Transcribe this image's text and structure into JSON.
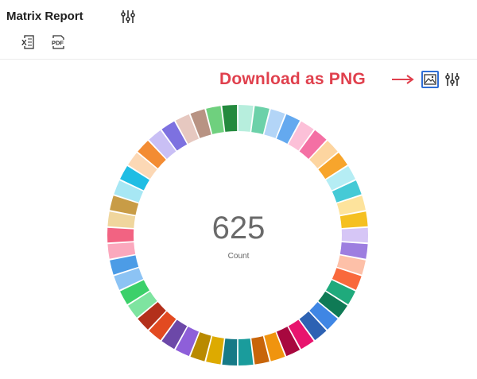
{
  "header": {
    "title": "Matrix Report",
    "settings_icon": "sliders-icon",
    "export_excel_icon": "excel-export-icon",
    "export_pdf_icon": "pdf-export-icon"
  },
  "annotation": {
    "text": "Download as PNG",
    "color": "#e0404d",
    "arrow_icon": "right-arrow-icon"
  },
  "chart_toolbar": {
    "download_png_icon": "image-icon",
    "settings_icon": "sliders-icon",
    "highlight_color": "#2f6ed6"
  },
  "chart_data": {
    "type": "pie",
    "donut": true,
    "total": "625",
    "total_label": "Count",
    "colors": [
      "#b7eedd",
      "#6cd1a9",
      "#b3d5f7",
      "#64a9ef",
      "#fcc0d8",
      "#f470a4",
      "#fdd5a0",
      "#f7a52c",
      "#b5edf4",
      "#45cad6",
      "#fde39c",
      "#f5c021",
      "#d6c6f6",
      "#9d7ee0",
      "#fdc0a8",
      "#f9693c",
      "#1faa7c",
      "#0f7a55",
      "#3f86e4",
      "#2d62b3",
      "#e8146e",
      "#a8083f",
      "#f0940f",
      "#c8650a",
      "#1a9c9c",
      "#167a87",
      "#ddaa00",
      "#b98a00",
      "#8e5fd9",
      "#6c48a8",
      "#e24a21",
      "#b3301b",
      "#7ee4a0",
      "#3cd06a",
      "#8cc3f4",
      "#4c9ce6",
      "#fba8bd",
      "#f26382",
      "#f0d69d",
      "#c89c46",
      "#a7e7f4",
      "#1fbde4",
      "#fcd8b5",
      "#f38c33",
      "#c9bff5",
      "#7d71e0",
      "#e6c8c0",
      "#b89383",
      "#6fd07e",
      "#248a3e"
    ]
  }
}
